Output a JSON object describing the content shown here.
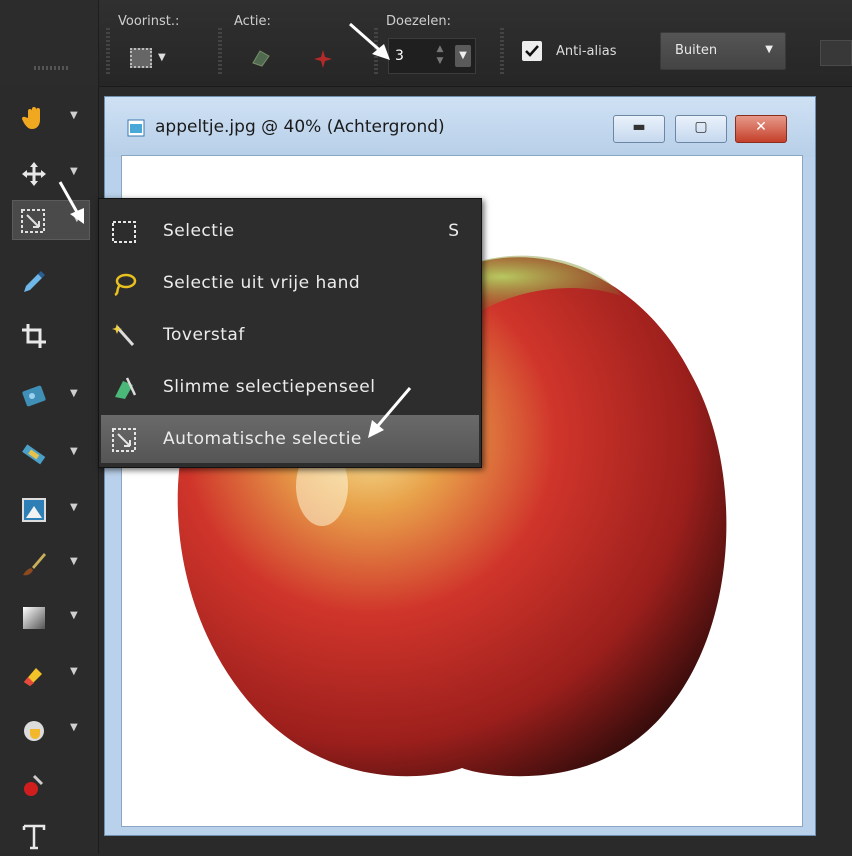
{
  "options_bar": {
    "preset_label": "Voorinst.:",
    "action_label": "Actie:",
    "feather_label": "Doezelen:",
    "feather_value": "3",
    "antialias_label": "Anti-alias",
    "antialias_checked": true,
    "mode_value": "Buiten"
  },
  "tools": [
    {
      "icon": "hand-icon"
    },
    {
      "icon": "move-icon"
    },
    {
      "icon": "selection-tool-icon",
      "active": true
    },
    {
      "icon": "eyedropper-icon"
    },
    {
      "icon": "crop-icon"
    },
    {
      "icon": "retouch-icon"
    },
    {
      "icon": "straighten-icon"
    },
    {
      "icon": "picture-tube-icon"
    },
    {
      "icon": "paint-brush-icon"
    },
    {
      "icon": "gradient-icon"
    },
    {
      "icon": "eraser-icon"
    },
    {
      "icon": "fill-icon"
    },
    {
      "icon": "red-eye-icon"
    },
    {
      "icon": "text-icon"
    }
  ],
  "document": {
    "title": "appeltje.jpg @  40% (Achtergrond)"
  },
  "flyout": {
    "items": [
      {
        "label": "Selectie",
        "shortcut": "S"
      },
      {
        "label": "Selectie uit vrije hand"
      },
      {
        "label": "Toverstaf"
      },
      {
        "label": "Slimme selectiepenseel"
      },
      {
        "label": "Automatische selectie",
        "selected": true
      }
    ]
  },
  "colors": {
    "dark_bg": "#2a2a2a",
    "selected_item": "#5f5f5f",
    "window_frame": "#b9d1ea"
  }
}
